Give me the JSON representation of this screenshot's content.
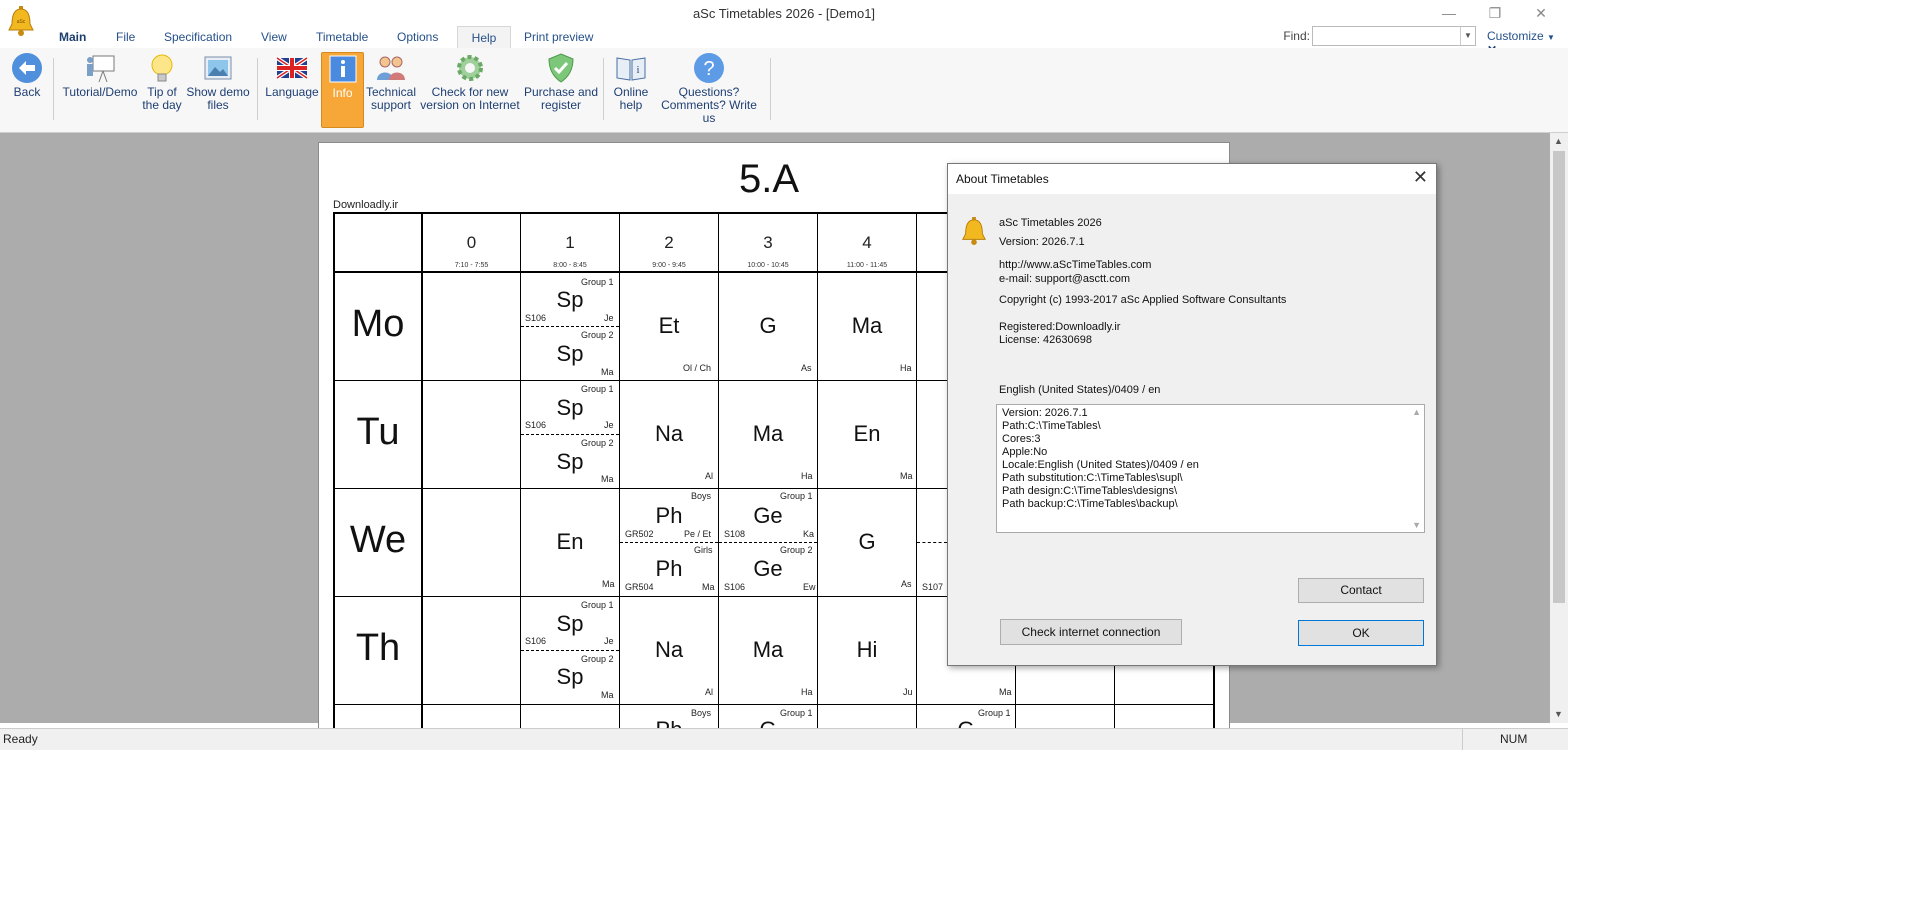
{
  "window": {
    "title": "aSc Timetables 2026  - [Demo1]",
    "minimize": "—",
    "maximize": "❐",
    "close": "✕"
  },
  "menu": [
    {
      "label": "Main"
    },
    {
      "label": "File"
    },
    {
      "label": "Specification"
    },
    {
      "label": "View"
    },
    {
      "label": "Timetable"
    },
    {
      "label": "Options"
    },
    {
      "label": "Help"
    },
    {
      "label": "Print preview"
    }
  ],
  "find": {
    "label": "Find:",
    "value": ""
  },
  "customize": {
    "label": "Customize",
    "close": "✕"
  },
  "ribbon": [
    {
      "line1": "Back",
      "line2": "",
      "icon": "back-arrow-icon"
    },
    {
      "line1": "Tutorial/Demo",
      "line2": "",
      "icon": "presentation-icon"
    },
    {
      "line1": "Tip of",
      "line2": "the day",
      "icon": "lightbulb-icon"
    },
    {
      "line1": "Show demo",
      "line2": "files",
      "icon": "image-icon"
    },
    {
      "line1": "Language",
      "line2": "",
      "icon": "flag-icon"
    },
    {
      "line1": "Info",
      "line2": "",
      "icon": "info-icon"
    },
    {
      "line1": "Technical",
      "line2": "support",
      "icon": "people-icon"
    },
    {
      "line1": "Check for new",
      "line2": "version on Internet",
      "icon": "gear-icon"
    },
    {
      "line1": "Purchase and",
      "line2": "register",
      "icon": "shield-check-icon"
    },
    {
      "line1": "Online",
      "line2": "help",
      "icon": "book-icon"
    },
    {
      "line1": "Questions?",
      "line2": "Comments? Write us",
      "icon": "question-icon"
    }
  ],
  "timetable": {
    "class_name": "5.A",
    "watermark": "Downloadly.ir",
    "periods": [
      {
        "num": "0",
        "time": "7:10 - 7:55"
      },
      {
        "num": "1",
        "time": "8:00 - 8:45"
      },
      {
        "num": "2",
        "time": "9:00 - 9:45"
      },
      {
        "num": "3",
        "time": "10:00 - 10:45"
      },
      {
        "num": "4",
        "time": "11:00 - 11:45"
      }
    ],
    "days": [
      "Mo",
      "Tu",
      "We",
      "Th"
    ],
    "cells": {
      "mo": {
        "p1": {
          "g1": "Group 1",
          "s1": "Sp",
          "room1": "S106",
          "t1": "Je",
          "g2": "Group 2",
          "s2": "Sp",
          "t2": "Ma"
        },
        "p2": {
          "s": "Et",
          "t": "Ol / Ch"
        },
        "p3": {
          "s": "G",
          "t": "As"
        },
        "p4": {
          "s": "Ma",
          "t": "Ha"
        }
      },
      "tu": {
        "p1": {
          "g1": "Group 1",
          "s1": "Sp",
          "room1": "S106",
          "t1": "Je",
          "g2": "Group 2",
          "s2": "Sp",
          "t2": "Ma"
        },
        "p2": {
          "s": "Na",
          "t": "Al"
        },
        "p3": {
          "s": "Ma",
          "t": "Ha"
        },
        "p4": {
          "s": "En",
          "t": "Ma"
        }
      },
      "we": {
        "p1": {
          "s": "En",
          "t": "Ma"
        },
        "p2": {
          "g1": "Boys",
          "s1": "Ph",
          "room1": "GR502",
          "t1": "Pe / Et",
          "g2": "Girls",
          "s2": "Ph",
          "room2": "GR504",
          "t2": "Ma"
        },
        "p3": {
          "g1": "Group 1",
          "s1": "Ge",
          "room1": "S108",
          "t1": "Ka",
          "g2": "Group 2",
          "s2": "Ge",
          "room2": "S106",
          "t2": "Ew"
        },
        "p4": {
          "s": "G",
          "t": "As"
        },
        "p5_room": "S107"
      },
      "th": {
        "p1": {
          "g1": "Group 1",
          "s1": "Sp",
          "room1": "S106",
          "t1": "Je",
          "g2": "Group 2",
          "s2": "Sp",
          "t2": "Ma"
        },
        "p2": {
          "s": "Na",
          "t": "Al"
        },
        "p3": {
          "s": "Ma",
          "t": "Ha"
        },
        "p4": {
          "s": "Hi",
          "t": "Ju"
        },
        "p5_teacher": "Ma"
      },
      "fr": {
        "p2_group": "Boys",
        "p3_group": "Group 1",
        "p5_group": "Group 1",
        "p2_peek": "Ph",
        "p3_peek": "G",
        "p5_peek": "G"
      }
    }
  },
  "dialog": {
    "title": "About Timetables",
    "product": "aSc Timetables 2026",
    "version": "Version: 2026.7.1",
    "url": "http://www.aScTimeTables.com",
    "email": "e-mail: support@asctt.com",
    "copyright": "Copyright (c) 1993-2017 aSc Applied Software Consultants",
    "registered": "Registered:Downloadly.ir",
    "license": "License: 42630698",
    "locale": "English (United States)/0409 / en",
    "info_lines": [
      "Version: 2026.7.1",
      "Path:C:\\TimeTables\\",
      "Cores:3",
      "Apple:No",
      "Locale:English (United States)/0409 / en",
      "Path substitution:C:\\TimeTables\\supl\\",
      "Path design:C:\\TimeTables\\designs\\",
      "Path backup:C:\\TimeTables\\backup\\"
    ],
    "contact_button": "Contact",
    "check_button": "Check internet connection",
    "ok_button": "OK"
  },
  "status": {
    "text": "Ready",
    "num": "NUM"
  },
  "colors": {
    "accent": "#f6a737",
    "menu_text": "#26508a",
    "workspace": "#acacac"
  }
}
